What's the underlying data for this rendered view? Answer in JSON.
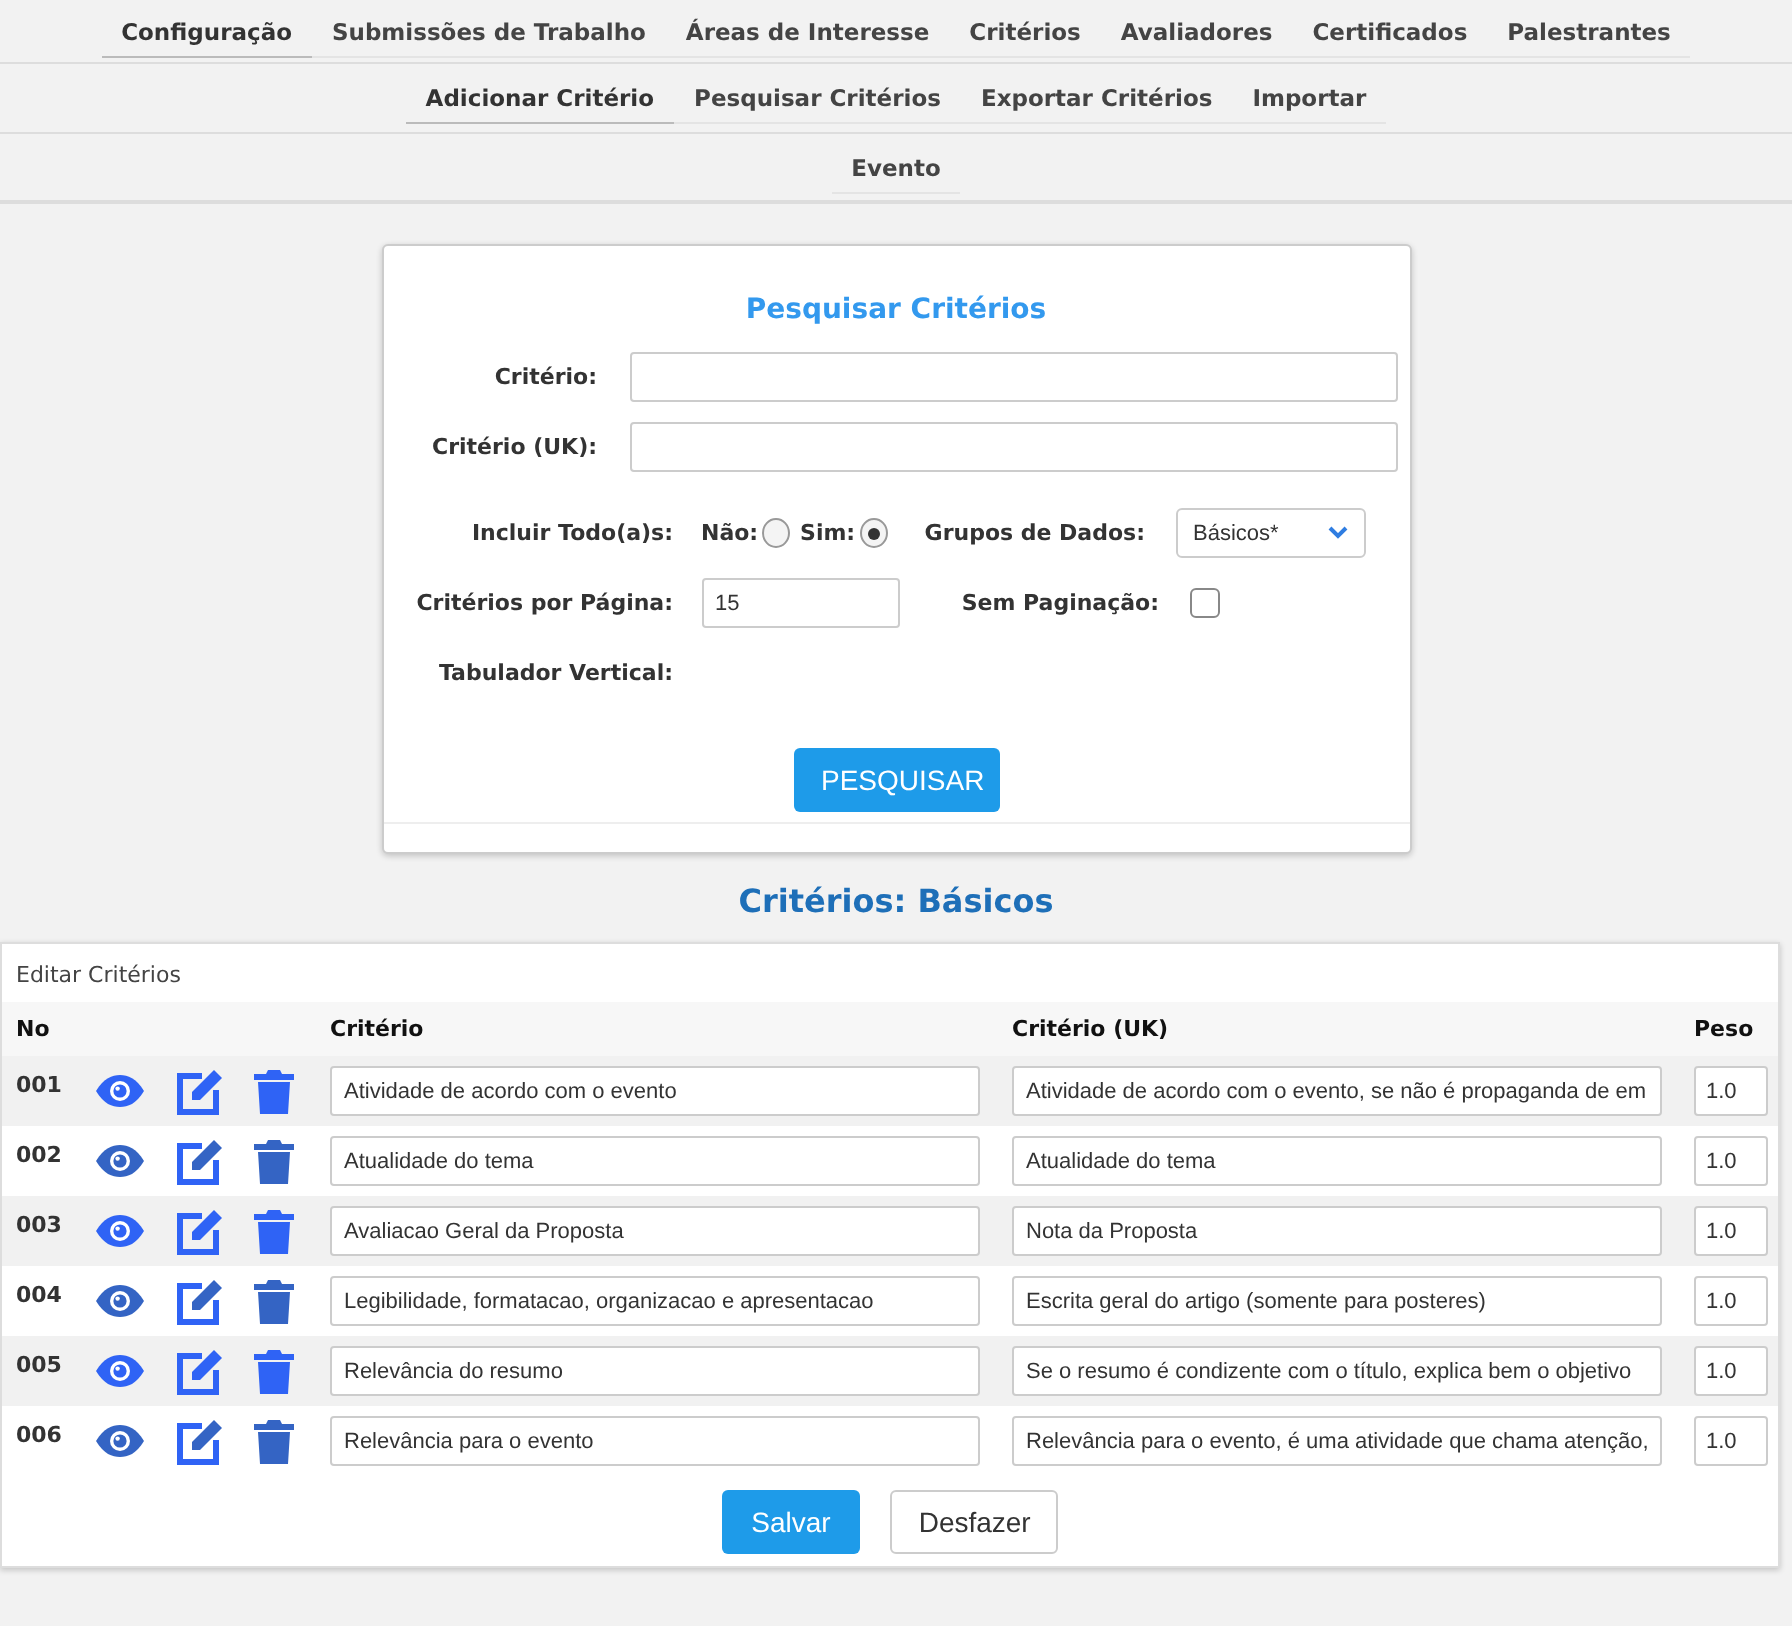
{
  "main_tabs": [
    {
      "label": "Configuração",
      "selected": true
    },
    {
      "label": "Submissões de Trabalho",
      "selected": false
    },
    {
      "label": "Áreas de Interesse",
      "selected": false
    },
    {
      "label": "Critérios",
      "selected": false
    },
    {
      "label": "Avaliadores",
      "selected": false
    },
    {
      "label": "Certificados",
      "selected": false
    },
    {
      "label": "Palestrantes",
      "selected": false
    }
  ],
  "sub_tabs": [
    {
      "label": "Adicionar Critério",
      "selected": true
    },
    {
      "label": "Pesquisar Critérios",
      "selected": false
    },
    {
      "label": "Exportar Critérios",
      "selected": false
    },
    {
      "label": "Importar",
      "selected": false
    }
  ],
  "context_tab": {
    "label": "Evento"
  },
  "search_form": {
    "title": "Pesquisar Critérios",
    "criterion_label": "Critério:",
    "criterion_uk_label": "Critério (UK):",
    "include_all": {
      "label": "Incluir Todo(a)s:",
      "options": [
        {
          "label": "Não:",
          "selected": false
        },
        {
          "label": "Sim:",
          "selected": true
        }
      ]
    },
    "data_groups": {
      "label": "Grupos de Dados:",
      "value": "Básicos*"
    },
    "per_page": {
      "label": "Critérios por Página:",
      "value": "15"
    },
    "no_pagination": {
      "label": "Sem Paginação:",
      "checked": false
    },
    "vertical_tab_label": "Tabulador Vertical:",
    "button": "PESQUISAR"
  },
  "results_title": "Critérios: Básicos",
  "table": {
    "caption": "Editar Critérios",
    "columns": [
      "No",
      "Critério",
      "Critério (UK)",
      "Peso"
    ],
    "rows": [
      {
        "no": "001",
        "criterion": "Atividade de acordo com o evento",
        "criterion_uk": "Atividade de acordo com o evento, se não é propaganda de em",
        "weight": "1.0"
      },
      {
        "no": "002",
        "criterion": "Atualidade do tema",
        "criterion_uk": "Atualidade do tema",
        "weight": "1.0"
      },
      {
        "no": "003",
        "criterion": "Avaliacao Geral da Proposta",
        "criterion_uk": "Nota da Proposta",
        "weight": "1.0"
      },
      {
        "no": "004",
        "criterion": "Legibilidade, formatacao, organizacao e apresentacao",
        "criterion_uk": "Escrita geral do artigo (somente para posteres)",
        "weight": "1.0"
      },
      {
        "no": "005",
        "criterion": "Relevância do resumo",
        "criterion_uk": "Se o resumo é condizente com o título, explica bem o objetivo",
        "weight": "1.0"
      },
      {
        "no": "006",
        "criterion": "Relevância para o evento",
        "criterion_uk": "Relevância para o evento, é uma atividade que chama atenção,",
        "weight": "1.0"
      }
    ]
  },
  "buttons": {
    "save": "Salvar",
    "undo": "Desfazer"
  }
}
